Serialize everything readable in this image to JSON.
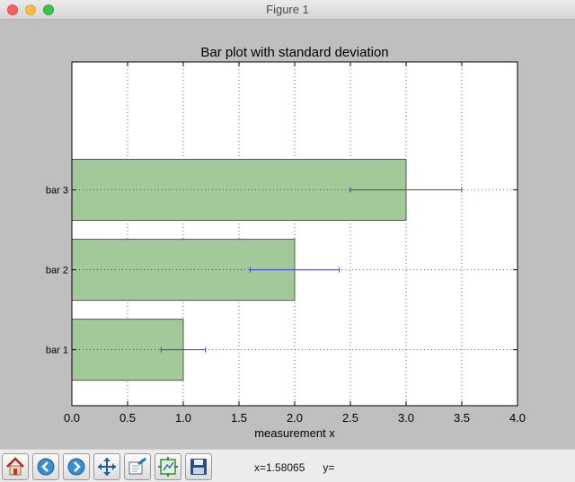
{
  "window": {
    "title": "Figure 1"
  },
  "chart_data": {
    "type": "bar",
    "orientation": "horizontal",
    "title": "Bar plot with standard deviation",
    "xlabel": "measurement x",
    "ylabel": "",
    "categories": [
      "bar 1",
      "bar 2",
      "bar 3"
    ],
    "values": [
      1.0,
      2.0,
      3.0
    ],
    "errors": [
      0.2,
      0.4,
      0.5
    ],
    "xlim": [
      0.0,
      4.0
    ],
    "xticks": [
      "0.0",
      "0.5",
      "1.0",
      "1.5",
      "2.0",
      "2.5",
      "3.0",
      "3.5",
      "4.0"
    ],
    "grid": true,
    "colors": {
      "bar": "#a3c99b",
      "bar_edge": "#4d5c4a",
      "error": "#3b3bd0"
    }
  },
  "toolbar": {
    "buttons": [
      {
        "name": "home-button",
        "icon": "home-icon"
      },
      {
        "name": "back-button",
        "icon": "back-arrow-icon"
      },
      {
        "name": "forward-button",
        "icon": "forward-arrow-icon"
      },
      {
        "name": "pan-button",
        "icon": "pan-arrows-icon"
      },
      {
        "name": "zoom-button",
        "icon": "zoom-rect-icon"
      },
      {
        "name": "subplots-button",
        "icon": "subplots-icon"
      },
      {
        "name": "save-button",
        "icon": "floppy-disk-icon"
      }
    ],
    "x_readout": "x=1.58065",
    "y_readout": "y="
  }
}
